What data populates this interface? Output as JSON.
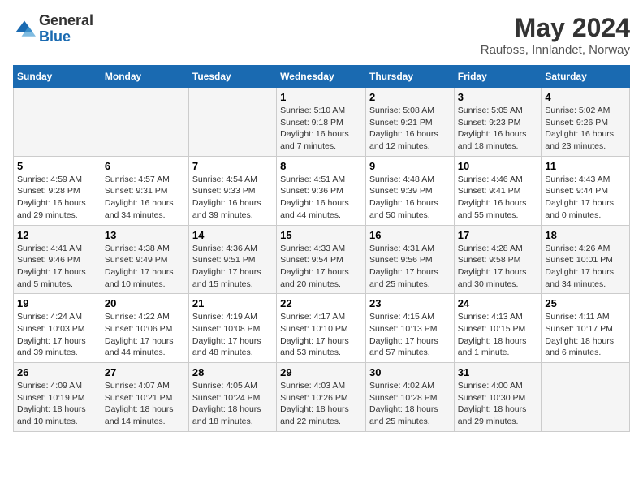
{
  "header": {
    "logo_general": "General",
    "logo_blue": "Blue",
    "month_title": "May 2024",
    "location": "Raufoss, Innlandet, Norway"
  },
  "days_of_week": [
    "Sunday",
    "Monday",
    "Tuesday",
    "Wednesday",
    "Thursday",
    "Friday",
    "Saturday"
  ],
  "weeks": [
    [
      {
        "day": "",
        "info": ""
      },
      {
        "day": "",
        "info": ""
      },
      {
        "day": "",
        "info": ""
      },
      {
        "day": "1",
        "info": "Sunrise: 5:10 AM\nSunset: 9:18 PM\nDaylight: 16 hours\nand 7 minutes."
      },
      {
        "day": "2",
        "info": "Sunrise: 5:08 AM\nSunset: 9:21 PM\nDaylight: 16 hours\nand 12 minutes."
      },
      {
        "day": "3",
        "info": "Sunrise: 5:05 AM\nSunset: 9:23 PM\nDaylight: 16 hours\nand 18 minutes."
      },
      {
        "day": "4",
        "info": "Sunrise: 5:02 AM\nSunset: 9:26 PM\nDaylight: 16 hours\nand 23 minutes."
      }
    ],
    [
      {
        "day": "5",
        "info": "Sunrise: 4:59 AM\nSunset: 9:28 PM\nDaylight: 16 hours\nand 29 minutes."
      },
      {
        "day": "6",
        "info": "Sunrise: 4:57 AM\nSunset: 9:31 PM\nDaylight: 16 hours\nand 34 minutes."
      },
      {
        "day": "7",
        "info": "Sunrise: 4:54 AM\nSunset: 9:33 PM\nDaylight: 16 hours\nand 39 minutes."
      },
      {
        "day": "8",
        "info": "Sunrise: 4:51 AM\nSunset: 9:36 PM\nDaylight: 16 hours\nand 44 minutes."
      },
      {
        "day": "9",
        "info": "Sunrise: 4:48 AM\nSunset: 9:39 PM\nDaylight: 16 hours\nand 50 minutes."
      },
      {
        "day": "10",
        "info": "Sunrise: 4:46 AM\nSunset: 9:41 PM\nDaylight: 16 hours\nand 55 minutes."
      },
      {
        "day": "11",
        "info": "Sunrise: 4:43 AM\nSunset: 9:44 PM\nDaylight: 17 hours\nand 0 minutes."
      }
    ],
    [
      {
        "day": "12",
        "info": "Sunrise: 4:41 AM\nSunset: 9:46 PM\nDaylight: 17 hours\nand 5 minutes."
      },
      {
        "day": "13",
        "info": "Sunrise: 4:38 AM\nSunset: 9:49 PM\nDaylight: 17 hours\nand 10 minutes."
      },
      {
        "day": "14",
        "info": "Sunrise: 4:36 AM\nSunset: 9:51 PM\nDaylight: 17 hours\nand 15 minutes."
      },
      {
        "day": "15",
        "info": "Sunrise: 4:33 AM\nSunset: 9:54 PM\nDaylight: 17 hours\nand 20 minutes."
      },
      {
        "day": "16",
        "info": "Sunrise: 4:31 AM\nSunset: 9:56 PM\nDaylight: 17 hours\nand 25 minutes."
      },
      {
        "day": "17",
        "info": "Sunrise: 4:28 AM\nSunset: 9:58 PM\nDaylight: 17 hours\nand 30 minutes."
      },
      {
        "day": "18",
        "info": "Sunrise: 4:26 AM\nSunset: 10:01 PM\nDaylight: 17 hours\nand 34 minutes."
      }
    ],
    [
      {
        "day": "19",
        "info": "Sunrise: 4:24 AM\nSunset: 10:03 PM\nDaylight: 17 hours\nand 39 minutes."
      },
      {
        "day": "20",
        "info": "Sunrise: 4:22 AM\nSunset: 10:06 PM\nDaylight: 17 hours\nand 44 minutes."
      },
      {
        "day": "21",
        "info": "Sunrise: 4:19 AM\nSunset: 10:08 PM\nDaylight: 17 hours\nand 48 minutes."
      },
      {
        "day": "22",
        "info": "Sunrise: 4:17 AM\nSunset: 10:10 PM\nDaylight: 17 hours\nand 53 minutes."
      },
      {
        "day": "23",
        "info": "Sunrise: 4:15 AM\nSunset: 10:13 PM\nDaylight: 17 hours\nand 57 minutes."
      },
      {
        "day": "24",
        "info": "Sunrise: 4:13 AM\nSunset: 10:15 PM\nDaylight: 18 hours\nand 1 minute."
      },
      {
        "day": "25",
        "info": "Sunrise: 4:11 AM\nSunset: 10:17 PM\nDaylight: 18 hours\nand 6 minutes."
      }
    ],
    [
      {
        "day": "26",
        "info": "Sunrise: 4:09 AM\nSunset: 10:19 PM\nDaylight: 18 hours\nand 10 minutes."
      },
      {
        "day": "27",
        "info": "Sunrise: 4:07 AM\nSunset: 10:21 PM\nDaylight: 18 hours\nand 14 minutes."
      },
      {
        "day": "28",
        "info": "Sunrise: 4:05 AM\nSunset: 10:24 PM\nDaylight: 18 hours\nand 18 minutes."
      },
      {
        "day": "29",
        "info": "Sunrise: 4:03 AM\nSunset: 10:26 PM\nDaylight: 18 hours\nand 22 minutes."
      },
      {
        "day": "30",
        "info": "Sunrise: 4:02 AM\nSunset: 10:28 PM\nDaylight: 18 hours\nand 25 minutes."
      },
      {
        "day": "31",
        "info": "Sunrise: 4:00 AM\nSunset: 10:30 PM\nDaylight: 18 hours\nand 29 minutes."
      },
      {
        "day": "",
        "info": ""
      }
    ]
  ]
}
